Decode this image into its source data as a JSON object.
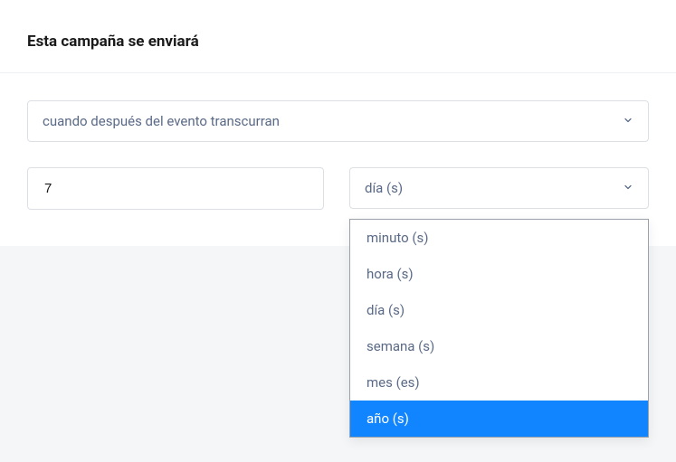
{
  "header": {
    "title": "Esta campaña se enviará"
  },
  "timing": {
    "condition_selected": "cuando después del evento transcurran",
    "quantity_value": "7",
    "unit_selected": "día (s)",
    "unit_options": [
      {
        "label": "minuto (s)",
        "highlighted": false
      },
      {
        "label": "hora (s)",
        "highlighted": false
      },
      {
        "label": "día (s)",
        "highlighted": false
      },
      {
        "label": "semana (s)",
        "highlighted": false
      },
      {
        "label": "mes (es)",
        "highlighted": false
      },
      {
        "label": "año (s)",
        "highlighted": true
      }
    ]
  }
}
